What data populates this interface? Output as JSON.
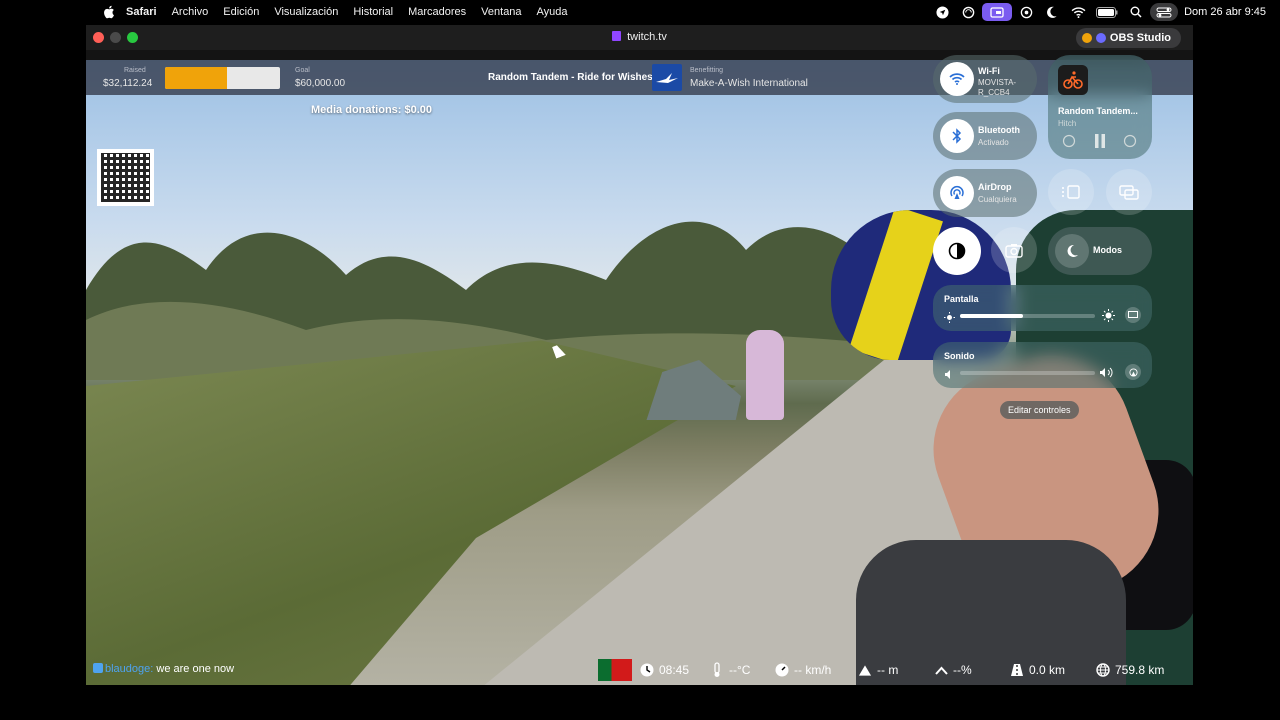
{
  "menubar": {
    "app": "Safari",
    "items": [
      "Archivo",
      "Edición",
      "Visualización",
      "Historial",
      "Marcadores",
      "Ventana",
      "Ayuda"
    ],
    "datetime": "Dom 26 abr 9:45",
    "icons": [
      "apple-icon",
      "location-arrow-icon",
      "sync-icon",
      "screen-record-icon",
      "chatgpt-icon",
      "focus-moon-icon",
      "wifi-icon",
      "battery-icon",
      "search-icon",
      "control-center-icon"
    ]
  },
  "window": {
    "url": "twitch.tv",
    "obs_label": "OBS Studio"
  },
  "stream": {
    "raised_label": "Raised",
    "raised_value": "$32,112.24",
    "raised_fraction": 0.535,
    "goal_label": "Goal",
    "goal_value": "$60,000.00",
    "title": "Random Tandem - Ride for Wishes",
    "benefitting_label": "Benefitting",
    "benefitting_value": "Make-A-Wish International",
    "media_donations": "Media donations: $0.00",
    "chat_user": "blaudoge:",
    "chat_message": "we are one now",
    "stats": {
      "time": "08:45",
      "temperature": "--°C",
      "speed": "-- km/h",
      "elevation": "-- m",
      "grade": "--%",
      "distance_today": "0.0 km",
      "distance_total": "759.8 km"
    }
  },
  "control_center": {
    "wifi": {
      "label": "Wi-Fi",
      "sub": "MOVISTA-R_CCB4"
    },
    "bluetooth": {
      "label": "Bluetooth",
      "sub": "Activado"
    },
    "airdrop": {
      "label": "AirDrop",
      "sub": "Cualquiera"
    },
    "now_playing": {
      "title": "Random Tandem...",
      "sub": "Hitch"
    },
    "modos": "Modos",
    "display": {
      "label": "Pantalla",
      "level": 0.47
    },
    "sound": {
      "label": "Sonido",
      "level": 0.0
    },
    "edit_controls": "Editar controles"
  },
  "colors": {
    "accent": "#7a5cf0",
    "twitch": "#9146ff",
    "progress": "#f0a30a"
  }
}
